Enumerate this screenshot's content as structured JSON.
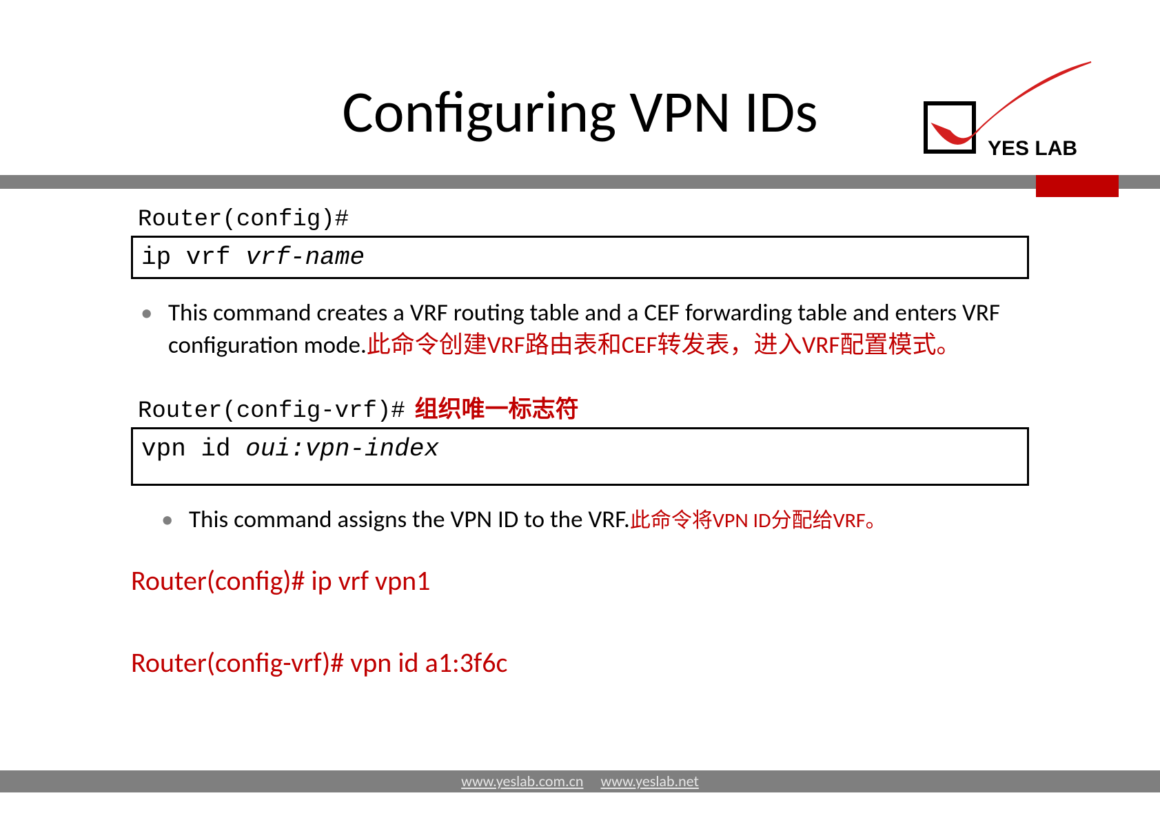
{
  "logo": {
    "text": "YES LAB"
  },
  "title": "Configuring VPN IDs",
  "block1": {
    "prompt": "Router(config)#",
    "cmd": "ip vrf ",
    "arg": "vrf-name",
    "bullet_en": "This command creates a VRF routing table and a CEF forwarding table and enters VRF configuration mode.",
    "bullet_cn": "此命令创建VRF路由表和CEF转发表，进入VRF配置模式。"
  },
  "block2": {
    "prompt": "Router(config-vrf)#",
    "note": "组织唯一标志符",
    "cmd": "vpn id ",
    "arg": "oui:vpn-index",
    "bullet_en": "This command assigns the VPN ID to the VRF.",
    "bullet_cn": "此命令将VPN ID分配给VRF。"
  },
  "examples": {
    "line1": "Router(config)# ip vrf vpn1",
    "line2": "Router(config-vrf)# vpn id a1:3f6c"
  },
  "footer": {
    "url1": "www.yeslab.com.cn",
    "url2": "www.yeslab.net"
  }
}
